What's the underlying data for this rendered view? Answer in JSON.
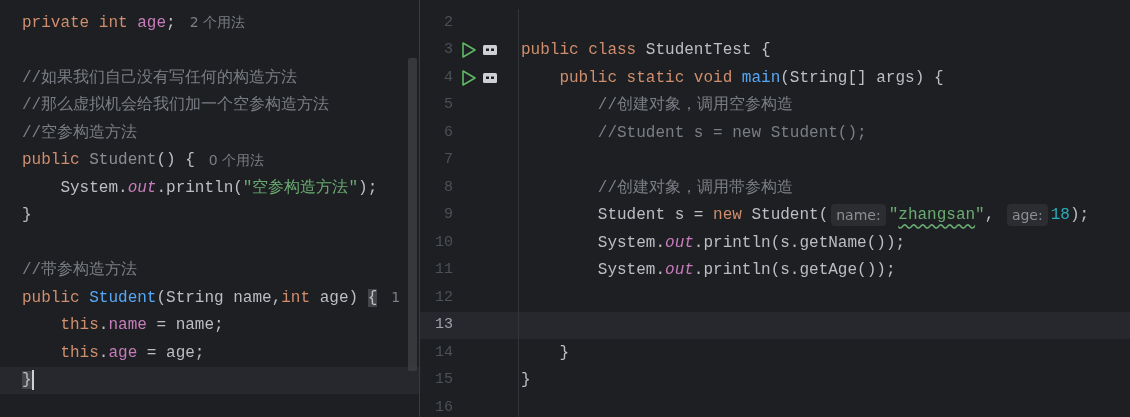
{
  "left_editor": {
    "lines": [
      {
        "current": false,
        "tokens": [
          {
            "kind": "keyword",
            "text": "private int "
          },
          {
            "kind": "field",
            "text": "age"
          },
          {
            "kind": "plain",
            "text": ";"
          },
          {
            "kind": "usage_hint",
            "text": "2 个用法"
          }
        ]
      },
      {
        "current": false
      },
      {
        "current": false,
        "tokens": [
          {
            "kind": "comment",
            "text": "//如果我们自己没有写任何的构造方法"
          }
        ]
      },
      {
        "current": false,
        "tokens": [
          {
            "kind": "comment",
            "text": "//那么虚拟机会给我们加一个空参构造方法"
          }
        ]
      },
      {
        "current": false,
        "tokens": [
          {
            "kind": "comment",
            "text": "//空参构造方法"
          }
        ]
      },
      {
        "current": false,
        "tokens": [
          {
            "kind": "keyword",
            "text": "public "
          },
          {
            "kind": "unused",
            "text": "Student"
          },
          {
            "kind": "plain",
            "text": "() {"
          },
          {
            "kind": "usage_hint",
            "text": "0 个用法"
          }
        ]
      },
      {
        "current": false,
        "tokens": [
          {
            "kind": "plain",
            "text": "    System."
          },
          {
            "kind": "static_field",
            "text": "out"
          },
          {
            "kind": "plain",
            "text": ".println("
          },
          {
            "kind": "string",
            "text": "\"空参构造方法\""
          },
          {
            "kind": "plain",
            "text": ");"
          }
        ]
      },
      {
        "current": false,
        "tokens": [
          {
            "kind": "plain",
            "text": "}"
          }
        ]
      },
      {
        "current": false
      },
      {
        "current": false,
        "tokens": [
          {
            "kind": "comment",
            "text": "//带参构造方法"
          }
        ]
      },
      {
        "current": false,
        "tokens": [
          {
            "kind": "keyword",
            "text": "public "
          },
          {
            "kind": "method",
            "text": "Student"
          },
          {
            "kind": "plain",
            "text": "(String name,"
          },
          {
            "kind": "keyword",
            "text": "int "
          },
          {
            "kind": "plain",
            "text": "age) "
          },
          {
            "kind": "brace_match",
            "text": "{"
          },
          {
            "kind": "usage_hint",
            "text": "1"
          }
        ]
      },
      {
        "current": false,
        "tokens": [
          {
            "kind": "keyword",
            "text": "    this"
          },
          {
            "kind": "plain",
            "text": "."
          },
          {
            "kind": "field",
            "text": "name"
          },
          {
            "kind": "plain",
            "text": " = name;"
          }
        ]
      },
      {
        "current": false,
        "tokens": [
          {
            "kind": "keyword",
            "text": "    this"
          },
          {
            "kind": "plain",
            "text": "."
          },
          {
            "kind": "field",
            "text": "age"
          },
          {
            "kind": "plain",
            "text": " = age;"
          }
        ]
      },
      {
        "current": true,
        "caret": true,
        "tokens": [
          {
            "kind": "brace_match",
            "text": "}"
          }
        ]
      }
    ]
  },
  "right_editor": {
    "lines": [
      {
        "number": "2",
        "current": false,
        "run_marker": false
      },
      {
        "number": "3",
        "current": false,
        "run_marker": true,
        "tokens": [
          {
            "kind": "keyword",
            "text": "public class "
          },
          {
            "kind": "plain",
            "text": "StudentTest {"
          }
        ]
      },
      {
        "number": "4",
        "current": false,
        "run_marker": true,
        "tokens": [
          {
            "kind": "keyword",
            "text": "    public static void "
          },
          {
            "kind": "method",
            "text": "main"
          },
          {
            "kind": "plain",
            "text": "(String[] args) {"
          }
        ]
      },
      {
        "number": "5",
        "current": false,
        "run_marker": false,
        "tokens": [
          {
            "kind": "comment",
            "text": "        //创建对象，调用空参构造"
          }
        ]
      },
      {
        "number": "6",
        "current": false,
        "run_marker": false,
        "tokens": [
          {
            "kind": "comment",
            "text": "        //Student s = new Student();"
          }
        ]
      },
      {
        "number": "7",
        "current": false,
        "run_marker": false
      },
      {
        "number": "8",
        "current": false,
        "run_marker": false,
        "tokens": [
          {
            "kind": "comment",
            "text": "        //创建对象，调用带参构造"
          }
        ]
      },
      {
        "number": "9",
        "current": false,
        "run_marker": false,
        "tokens": [
          {
            "kind": "plain",
            "text": "        Student s = "
          },
          {
            "kind": "keyword",
            "text": "new "
          },
          {
            "kind": "plain",
            "text": "Student("
          },
          {
            "kind": "inlay_hint",
            "text": "name:"
          },
          {
            "kind": "string",
            "text": "\""
          },
          {
            "kind": "string_warn",
            "text": "zhangsan"
          },
          {
            "kind": "string",
            "text": "\""
          },
          {
            "kind": "plain",
            "text": ", "
          },
          {
            "kind": "inlay_hint",
            "text": "age:"
          },
          {
            "kind": "number",
            "text": "18"
          },
          {
            "kind": "plain",
            "text": ");"
          }
        ]
      },
      {
        "number": "10",
        "current": false,
        "run_marker": false,
        "tokens": [
          {
            "kind": "plain",
            "text": "        System."
          },
          {
            "kind": "static_field",
            "text": "out"
          },
          {
            "kind": "plain",
            "text": ".println(s.getName());"
          }
        ]
      },
      {
        "number": "11",
        "current": false,
        "run_marker": false,
        "tokens": [
          {
            "kind": "plain",
            "text": "        System."
          },
          {
            "kind": "static_field",
            "text": "out"
          },
          {
            "kind": "plain",
            "text": ".println(s.getAge());"
          }
        ]
      },
      {
        "number": "12",
        "current": false,
        "run_marker": false
      },
      {
        "number": "13",
        "current": true,
        "run_marker": false
      },
      {
        "number": "14",
        "current": false,
        "run_marker": false,
        "tokens": [
          {
            "kind": "plain",
            "text": "    }"
          }
        ]
      },
      {
        "number": "15",
        "current": false,
        "run_marker": false,
        "tokens": [
          {
            "kind": "plain",
            "text": "}"
          }
        ]
      },
      {
        "number": "16",
        "current": false,
        "run_marker": false
      }
    ]
  }
}
